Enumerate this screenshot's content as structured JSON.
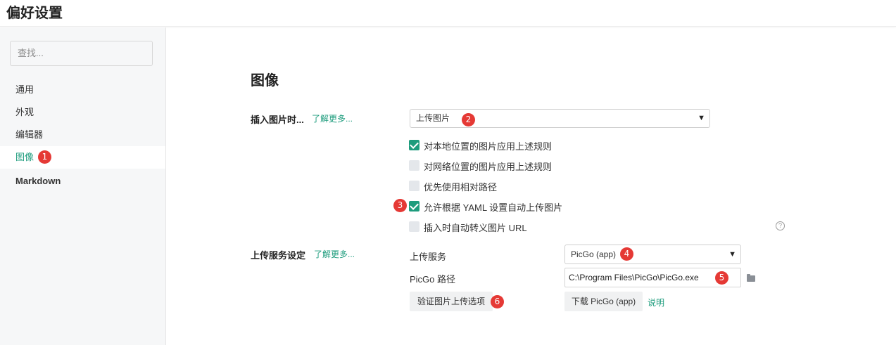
{
  "window": {
    "title": "偏好设置"
  },
  "sidebar": {
    "search_placeholder": "查找...",
    "items": [
      {
        "label": "通用"
      },
      {
        "label": "外观"
      },
      {
        "label": "编辑器"
      },
      {
        "label": "图像",
        "active": true
      },
      {
        "label": "Markdown"
      }
    ]
  },
  "main": {
    "section_title": "图像",
    "insert_image": {
      "label": "插入图片时...",
      "learn_more": "了解更多...",
      "select_value": "上传图片",
      "checkboxes": [
        {
          "label": "对本地位置的图片应用上述规则",
          "checked": true
        },
        {
          "label": "对网络位置的图片应用上述规则",
          "checked": false
        },
        {
          "label": "优先使用相对路径",
          "checked": false
        },
        {
          "label": "允许根据 YAML 设置自动上传图片",
          "checked": true
        },
        {
          "label": "插入时自动转义图片 URL",
          "checked": false
        }
      ]
    },
    "upload_service": {
      "label": "上传服务设定",
      "learn_more": "了解更多...",
      "service_label": "上传服务",
      "service_value": "PicGo (app)",
      "path_label": "PicGo 路径",
      "path_value": "C:\\Program Files\\PicGo\\PicGo.exe",
      "verify_button": "验证图片上传选项",
      "download_button": "下载 PicGo (app)",
      "explain_link": "说明"
    }
  },
  "annotations": [
    "1",
    "2",
    "3",
    "4",
    "5",
    "6"
  ],
  "colors": {
    "accent": "#1e9c7d",
    "badge": "#e53935",
    "sidebar_bg": "#f6f7f8"
  },
  "icons": {
    "help": "question-circle-icon",
    "folder": "folder-icon",
    "dropdown": "chevron-down-icon"
  }
}
